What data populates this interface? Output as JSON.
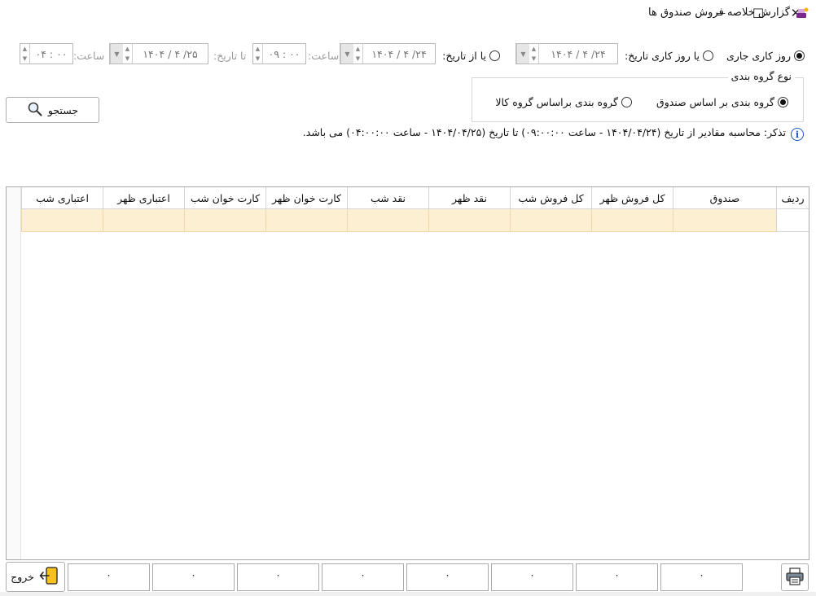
{
  "window": {
    "title": "گزارش خلاصه فروش صندوق ها",
    "minimize": "—",
    "maximize": "☐",
    "close": "✕"
  },
  "filters": {
    "current_day_label": "روز کاری جاری",
    "work_day_label": "یا روز کاری تاریخ:",
    "work_day_date": "۱۴۰۴ / ۴ /۲۴",
    "from_date_label": "یا از تاریخ:",
    "from_date": "۱۴۰۴ / ۴ /۲۴",
    "from_time_label": "ساعت:",
    "from_time": "۰۹ : ۰۰",
    "to_date_label": "تا تاریخ:",
    "to_date": "۱۴۰۴ / ۴ /۲۵",
    "to_time_label": "ساعت:",
    "to_time": "۰۴ : ۰۰"
  },
  "grouping": {
    "title": "نوع گروه بندی",
    "by_register": "گروه بندی بر اساس صندوق",
    "by_goods_group": "گروه بندی براساس گروه کالا"
  },
  "search_button": "جستجو",
  "note": "تذکر: محاسبه مقادیر از تاریخ (۱۴۰۴/۰۴/۲۴ - ساعت ۰۹:۰۰:۰۰) تا تاریخ (۱۴۰۴/۰۴/۲۵ - ساعت ۰۴:۰۰:۰۰) می باشد.",
  "table": {
    "columns": [
      "ردیف",
      "صندوق",
      "کل فروش ظهر",
      "کل فروش شب",
      "نقد ظهر",
      "نقد شب",
      "کارت خوان ظهر",
      "کارت خوان شب",
      "اعتباری ظهر",
      "اعتباری شب"
    ]
  },
  "totals": [
    "۰",
    "۰",
    "۰",
    "۰",
    "۰",
    "۰",
    "۰",
    "۰"
  ],
  "exit_button": "خروج",
  "icons": {
    "app": "app-icon",
    "search": "search-icon",
    "exit": "exit-icon",
    "print": "printer-icon",
    "info": "info-icon"
  }
}
